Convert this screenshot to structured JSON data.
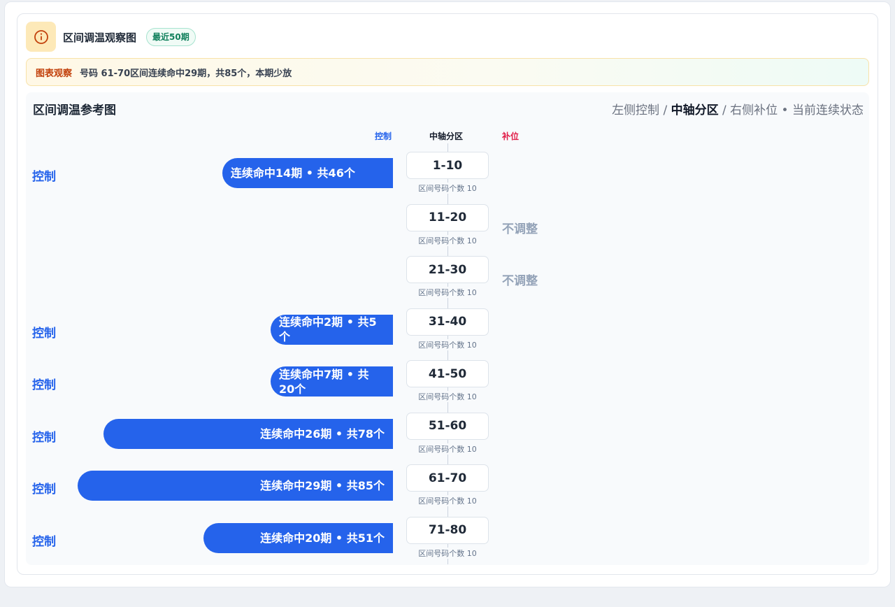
{
  "header": {
    "title": "区间调温观察图",
    "badge": "最近50期",
    "info_icon": "info-circle-icon"
  },
  "observation": {
    "tag": "图表观察",
    "text": "号码 61-70区间连续命中29期，共85个，本期少放"
  },
  "chart_data": {
    "type": "bar",
    "title": "区间调温参考图",
    "legend_text": {
      "left": "左侧控制",
      "sep1": " / ",
      "middle": "中轴分区",
      "sep2": " / ",
      "right": "右侧补位",
      "dot": " • ",
      "status": "当前连续状态"
    },
    "columns": {
      "left": "控制",
      "center": "中轴分区",
      "right": "补位"
    },
    "categories": [
      "1-10",
      "11-20",
      "21-30",
      "31-40",
      "41-50",
      "51-60",
      "61-70",
      "71-80"
    ],
    "sublabel": "区间号码个数 10",
    "series": [
      {
        "name": "控制",
        "values": [
          46,
          null,
          null,
          5,
          20,
          78,
          85,
          51
        ]
      }
    ],
    "rows": [
      {
        "range": "1-10",
        "side": "控制",
        "streak": 14,
        "total": 46,
        "bar_text": "连续命中14期 • 共46个",
        "status": ""
      },
      {
        "range": "11-20",
        "side": "",
        "streak": null,
        "total": null,
        "bar_text": "",
        "status": "不调整"
      },
      {
        "range": "21-30",
        "side": "",
        "streak": null,
        "total": null,
        "bar_text": "",
        "status": "不调整"
      },
      {
        "range": "31-40",
        "side": "控制",
        "streak": 2,
        "total": 5,
        "bar_text": "连续命中2期 • 共5个",
        "status": ""
      },
      {
        "range": "41-50",
        "side": "控制",
        "streak": 7,
        "total": 20,
        "bar_text": "连续命中7期 • 共20个",
        "status": ""
      },
      {
        "range": "51-60",
        "side": "控制",
        "streak": 26,
        "total": 78,
        "bar_text": "连续命中26期 • 共78个",
        "status": ""
      },
      {
        "range": "61-70",
        "side": "控制",
        "streak": 29,
        "total": 85,
        "bar_text": "连续命中29期 • 共85个",
        "status": ""
      },
      {
        "range": "71-80",
        "side": "控制",
        "streak": 20,
        "total": 51,
        "bar_text": "连续命中20期 • 共51个",
        "status": ""
      }
    ],
    "colors": {
      "control": "#2563eb",
      "supplement": "#e11d48",
      "neutral": "#94a3b8"
    }
  }
}
